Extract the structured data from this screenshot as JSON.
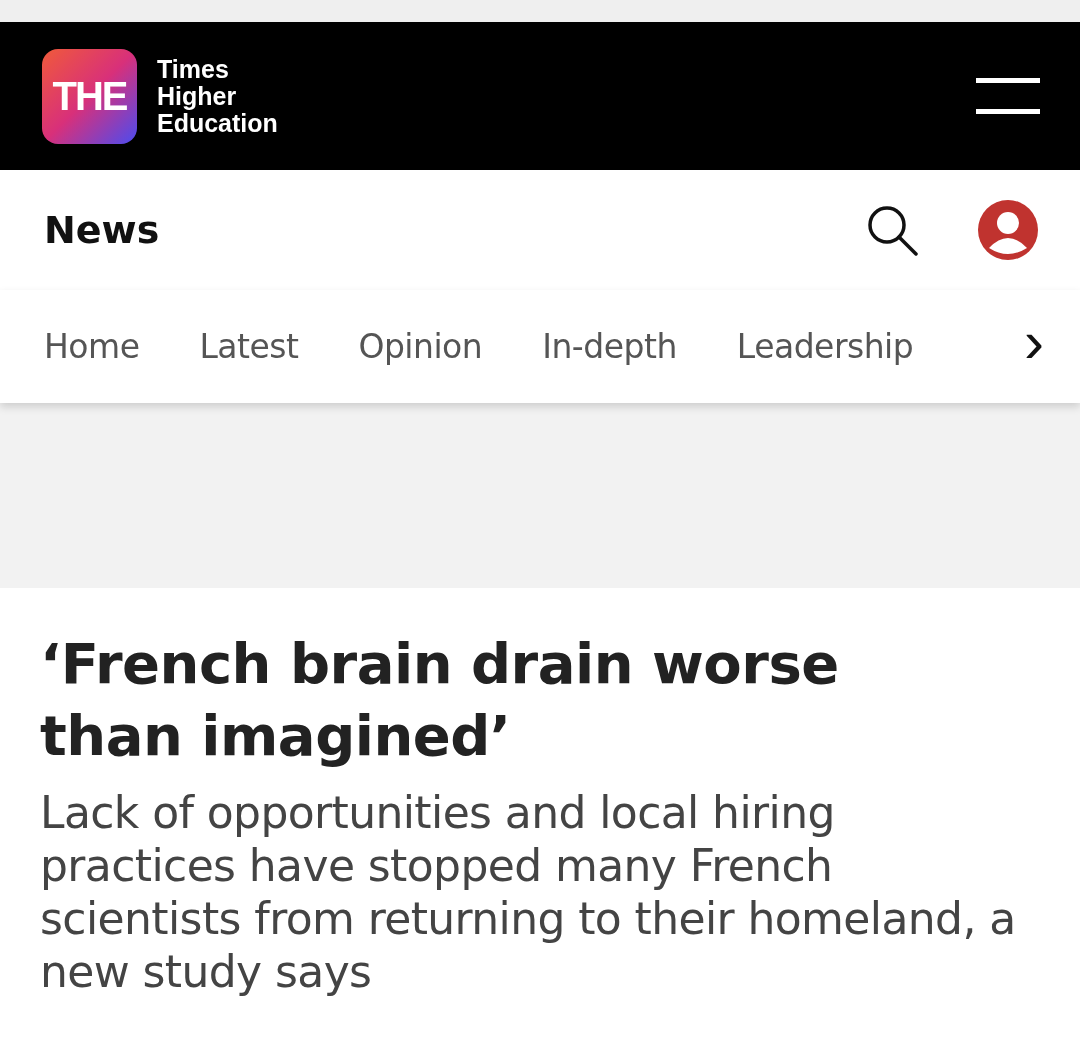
{
  "header": {
    "logo_mark": "THE",
    "logo_text": [
      "Times",
      "Higher",
      "Education"
    ]
  },
  "section": {
    "title": "News"
  },
  "nav": {
    "items": [
      "Home",
      "Latest",
      "Opinion",
      "In-depth",
      "Leadership"
    ],
    "more": "›"
  },
  "article": {
    "headline": "‘French brain drain worse than imagined’",
    "standfirst": "Lack of opportunities and local hiring practices have stopped many French scientists from returning to their homeland, a new study says"
  }
}
